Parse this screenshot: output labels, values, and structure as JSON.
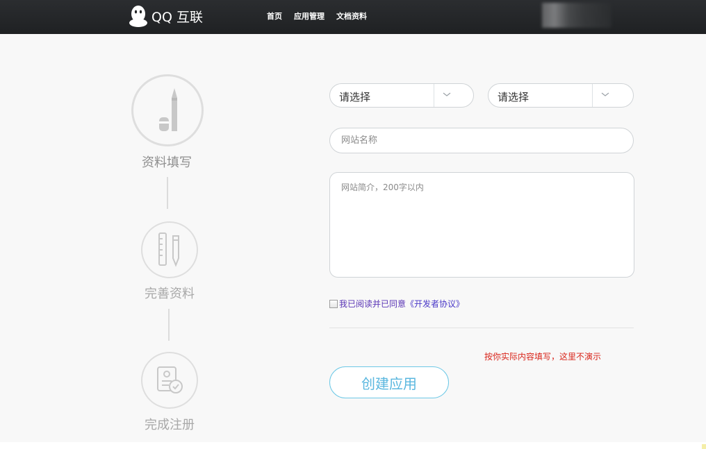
{
  "header": {
    "logo_text": "QQ 互联",
    "nav": [
      "首页",
      "应用管理",
      "文档资料"
    ]
  },
  "steps": [
    {
      "label": "资料填写",
      "icon": "pen-eraser-icon",
      "active": true
    },
    {
      "label": "完善资料",
      "icon": "ruler-pencil-icon",
      "active": false
    },
    {
      "label": "完成注册",
      "icon": "document-check-icon",
      "active": false
    }
  ],
  "form": {
    "select_1": {
      "value": "请选择"
    },
    "select_2": {
      "value": "请选择"
    },
    "site_name": {
      "placeholder": "网站名称",
      "value": ""
    },
    "site_desc": {
      "placeholder": "网站简介，200字以内",
      "value": ""
    },
    "agree": {
      "text": "我已阅读并已同意",
      "link": "《开发者协议》",
      "checked": false
    },
    "note": "按你实际内容填写，这里不演示",
    "submit_label": "创建应用"
  },
  "colors": {
    "topbar": "#232527",
    "accent": "#5ab7df",
    "note": "#d9261c",
    "link": "#4a39c8"
  }
}
